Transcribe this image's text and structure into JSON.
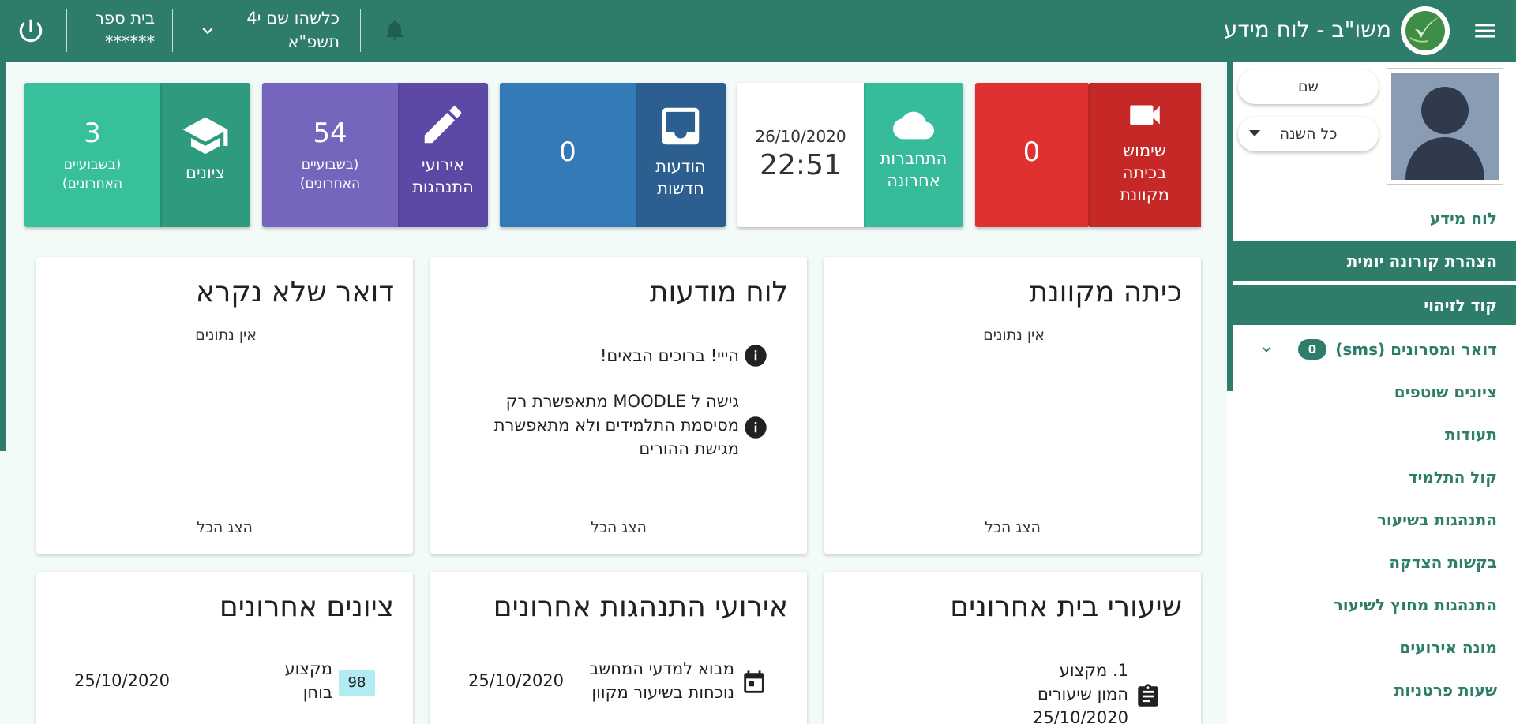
{
  "topbar": {
    "app_title": "משו\"ב - לוח מידע",
    "user_name": "כלשהו שם י4",
    "user_year": "תשפ\"א",
    "school_label": "בית ספר",
    "school_value": "******"
  },
  "sidebar": {
    "name_pill": "שם",
    "year_select": "כל השנה",
    "items": [
      {
        "label": "לוח מידע"
      },
      {
        "label": "הצהרת קורונה יומית"
      },
      {
        "label": "קוד לזיהוי"
      },
      {
        "label": "דואר ומסרונים (sms)",
        "badge": "0"
      },
      {
        "label": "ציונים שוטפים"
      },
      {
        "label": "תעודות"
      },
      {
        "label": "קול התלמיד"
      },
      {
        "label": "התנהגות בשיעור"
      },
      {
        "label": "בקשות הצדקה"
      },
      {
        "label": "התנהגות מחוץ לשיעור"
      },
      {
        "label": "מונה אירועים"
      },
      {
        "label": "שעות פרטניות"
      }
    ]
  },
  "tiles": {
    "online": {
      "label_1": "שימוש",
      "label_2": "בכיתה",
      "label_3": "מקוונת",
      "value": "0"
    },
    "last_login": {
      "label_1": "התחברות",
      "label_2": "אחרונה",
      "date": "26/10/2020",
      "time": "22:51"
    },
    "messages": {
      "label_1": "הודעות",
      "label_2": "חדשות",
      "value": "0"
    },
    "events": {
      "label_1": "אירועי",
      "label_2": "התנהגות",
      "value": "54",
      "sub_1": "(בשבועיים",
      "sub_2": "האחרונים)"
    },
    "grades": {
      "label": "ציונים",
      "value": "3",
      "sub_1": "(בשבועיים",
      "sub_2": "האחרונים)"
    }
  },
  "cards": {
    "online_class": {
      "title": "כיתה מקוונת",
      "empty": "אין נתונים",
      "show_all": "הצג הכל"
    },
    "notice_board": {
      "title": "לוח מודעות",
      "notice_1": "הייי! ברוכים הבאים!",
      "notice_2_line_1": "גישה ל MOODLE מתאפשרת רק",
      "notice_2_line_2": "מסיסמת התלמידים ולא מתאפשרת",
      "notice_2_line_3": "מגישת ההורים",
      "show_all": "הצג הכל"
    },
    "unread_mail": {
      "title": "דואר שלא נקרא",
      "empty": "אין נתונים",
      "show_all": "הצג הכל"
    },
    "homework": {
      "title": "שיעורי בית אחרונים",
      "row_line_1": "1. מקצוע",
      "row_line_2": "המון שיעורים",
      "row_line_3": "25/10/2020"
    },
    "behavior_events": {
      "title": "אירועי התנהגות אחרונים",
      "row_line_1": "מבוא למדעי המחשב",
      "row_line_2": "נוכחות בשיעור מקוון",
      "row_date": "25/10/2020"
    },
    "recent_grades": {
      "title": "ציונים אחרונים",
      "row_line_1": "מקצוע",
      "row_line_2": "בוחן",
      "grade": "98",
      "row_date": "25/10/2020"
    }
  },
  "colors": {
    "primary": "#2e7d6b",
    "online_tile": "#c62828",
    "login_tile": "#37bc9b",
    "messages_tile": "#2c5f8f",
    "events_tile": "#5e48a6",
    "grades_tile": "#2e9a7e"
  }
}
